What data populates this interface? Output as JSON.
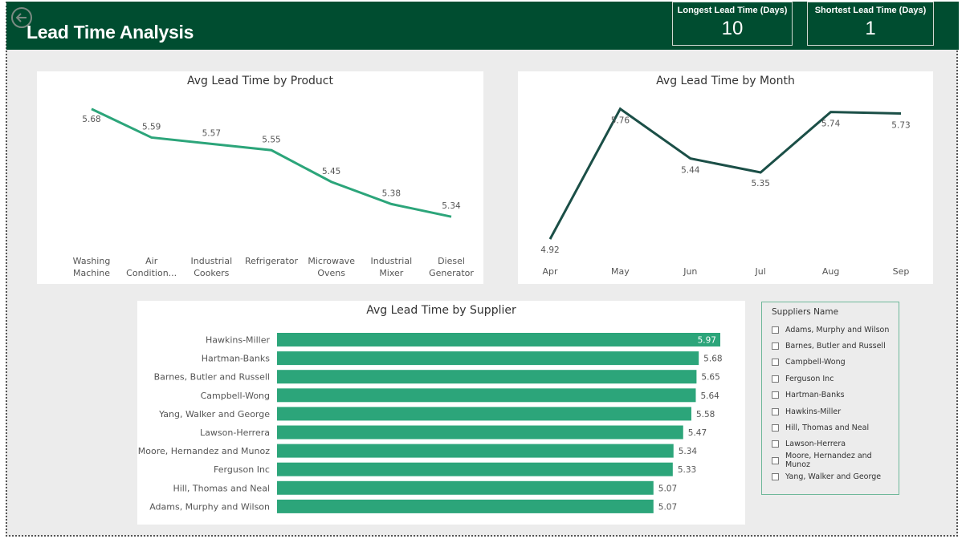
{
  "header": {
    "title": "Lead Time Analysis"
  },
  "kpis": [
    {
      "label": "Longest Lead Time (Days)",
      "value": "10"
    },
    {
      "label": "Shortest Lead Time (Days)",
      "value": "1"
    }
  ],
  "colors": {
    "header": "#004d30",
    "product_line": "#2ca57a",
    "month_line": "#1b4f47",
    "bars": "#2ca57a"
  },
  "charts": {
    "product": {
      "title": "Avg Lead Time by Product"
    },
    "month": {
      "title": "Avg Lead Time by Month"
    },
    "supplier": {
      "title": "Avg Lead Time by Supplier"
    }
  },
  "chart_data": [
    {
      "type": "line",
      "title": "Avg Lead Time by Product",
      "categories": [
        [
          "Washing",
          "Machine"
        ],
        [
          "Air",
          "Condition..."
        ],
        [
          "Industrial",
          "Cookers"
        ],
        [
          "Refrigerator",
          ""
        ],
        [
          "Microwave",
          "Ovens"
        ],
        [
          "Industrial",
          "Mixer"
        ],
        [
          "Diesel",
          "Generator"
        ]
      ],
      "values": [
        5.68,
        5.59,
        5.57,
        5.55,
        5.45,
        5.38,
        5.34
      ],
      "labels": [
        "5.68",
        "5.59",
        "5.57",
        "5.55",
        "5.45",
        "5.38",
        "5.34"
      ],
      "ylim": [
        5.3,
        5.7
      ]
    },
    {
      "type": "line",
      "title": "Avg Lead Time by Month",
      "categories": [
        "Apr",
        "May",
        "Jun",
        "Jul",
        "Aug",
        "Sep"
      ],
      "values": [
        4.92,
        5.76,
        5.44,
        5.35,
        5.74,
        5.73
      ],
      "labels": [
        "4.92",
        "5.76",
        "5.44",
        "5.35",
        "5.74",
        "5.73"
      ],
      "ylim": [
        4.9,
        5.8
      ]
    },
    {
      "type": "bar",
      "orientation": "horizontal",
      "title": "Avg Lead Time by Supplier",
      "categories": [
        "Hawkins-Miller",
        "Hartman-Banks",
        "Barnes, Butler and Russell",
        "Campbell-Wong",
        "Yang, Walker and George",
        "Lawson-Herrera",
        "Moore, Hernandez and Munoz",
        "Ferguson Inc",
        "Hill, Thomas and Neal",
        "Adams, Murphy and Wilson"
      ],
      "values": [
        5.97,
        5.68,
        5.65,
        5.64,
        5.58,
        5.47,
        5.34,
        5.33,
        5.07,
        5.07
      ],
      "labels": [
        "5.97",
        "5.68",
        "5.65",
        "5.64",
        "5.58",
        "5.47",
        "5.34",
        "5.33",
        "5.07",
        "5.07"
      ],
      "xlim": [
        0,
        5.97
      ]
    }
  ],
  "slicer": {
    "title": "Suppliers Name",
    "items": [
      "Adams, Murphy and Wilson",
      "Barnes, Butler and Russell",
      "Campbell-Wong",
      "Ferguson Inc",
      "Hartman-Banks",
      "Hawkins-Miller",
      "Hill, Thomas and Neal",
      "Lawson-Herrera",
      "Moore, Hernandez and Munoz",
      "Yang, Walker and George"
    ]
  }
}
